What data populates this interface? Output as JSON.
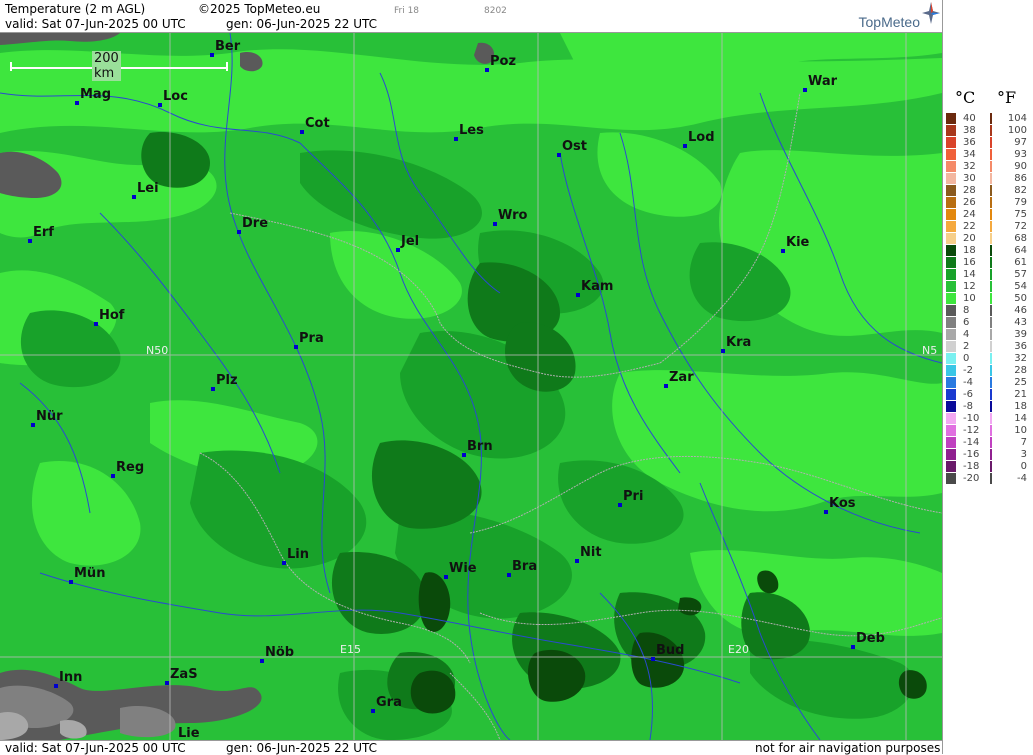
{
  "header": {
    "title": "Temperature (2 m AGL)",
    "copyright": "©2025 TopMeteo.eu",
    "day_marker": "Fri 18",
    "code": "8202",
    "valid": "valid:  Sat  07-Jun-2025  00 UTC",
    "gen": "gen: 06-Jun-2025 22 UTC",
    "logo": "TopMeteo"
  },
  "footer": {
    "valid": "valid:  Sat  07-Jun-2025  00 UTC",
    "gen": "gen: 06-Jun-2025 22 UTC",
    "disclaimer": "not for air navigation purposes"
  },
  "scale": {
    "label": "200 km"
  },
  "map_labels": {
    "lat_n50": "N50",
    "lat_n50_right": "N5",
    "lon_e15": "E15",
    "lon_e20": "E20"
  },
  "cities": [
    {
      "name": "Ber"
    },
    {
      "name": "Poz"
    },
    {
      "name": "War"
    },
    {
      "name": "Mag"
    },
    {
      "name": "Loc"
    },
    {
      "name": "Cot"
    },
    {
      "name": "Les"
    },
    {
      "name": "Ost"
    },
    {
      "name": "Lod"
    },
    {
      "name": "Lei"
    },
    {
      "name": "Erf"
    },
    {
      "name": "Dre"
    },
    {
      "name": "Wro"
    },
    {
      "name": "Jel"
    },
    {
      "name": "Kie"
    },
    {
      "name": "Kam"
    },
    {
      "name": "Hof"
    },
    {
      "name": "Pra"
    },
    {
      "name": "Kra"
    },
    {
      "name": "Plz"
    },
    {
      "name": "Zar"
    },
    {
      "name": "Nür"
    },
    {
      "name": "Brn"
    },
    {
      "name": "Reg"
    },
    {
      "name": "Pri"
    },
    {
      "name": "Kos"
    },
    {
      "name": "Lin"
    },
    {
      "name": "Wie"
    },
    {
      "name": "Bra"
    },
    {
      "name": "Nit"
    },
    {
      "name": "Mün"
    },
    {
      "name": "Deb"
    },
    {
      "name": "Nöb"
    },
    {
      "name": "Bud"
    },
    {
      "name": "Inn"
    },
    {
      "name": "ZaS"
    },
    {
      "name": "Gra"
    },
    {
      "name": "Lie"
    }
  ],
  "legend": {
    "unit_c": "°C",
    "unit_f": "°F",
    "rows": [
      {
        "c": "40",
        "f": "104",
        "color": "#6b2a0e"
      },
      {
        "c": "38",
        "f": "100",
        "color": "#a8381c"
      },
      {
        "c": "36",
        "f": "97",
        "color": "#d9432a"
      },
      {
        "c": "34",
        "f": "93",
        "color": "#f0603a"
      },
      {
        "c": "32",
        "f": "90",
        "color": "#f58a68"
      },
      {
        "c": "30",
        "f": "86",
        "color": "#f3b7a0"
      },
      {
        "c": "28",
        "f": "82",
        "color": "#8a5a1e"
      },
      {
        "c": "26",
        "f": "79",
        "color": "#b86e12"
      },
      {
        "c": "24",
        "f": "75",
        "color": "#e3880e"
      },
      {
        "c": "22",
        "f": "72",
        "color": "#f5a93e"
      },
      {
        "c": "20",
        "f": "68",
        "color": "#f6cf8a"
      },
      {
        "c": "18",
        "f": "64",
        "color": "#0a4a0a"
      },
      {
        "c": "16",
        "f": "61",
        "color": "#0f7a1a"
      },
      {
        "c": "14",
        "f": "57",
        "color": "#18a22a"
      },
      {
        "c": "12",
        "f": "54",
        "color": "#28c038"
      },
      {
        "c": "10",
        "f": "50",
        "color": "#3ee63e"
      },
      {
        "c": "8",
        "f": "46",
        "color": "#5a5a5a"
      },
      {
        "c": "6",
        "f": "43",
        "color": "#808080"
      },
      {
        "c": "4",
        "f": "39",
        "color": "#a8a8a8"
      },
      {
        "c": "2",
        "f": "36",
        "color": "#d0d0d0"
      },
      {
        "c": "0",
        "f": "32",
        "color": "#7af0f0"
      },
      {
        "c": "-2",
        "f": "28",
        "color": "#3ac6e6"
      },
      {
        "c": "-4",
        "f": "25",
        "color": "#2a7ae0"
      },
      {
        "c": "-6",
        "f": "21",
        "color": "#1a3ad0"
      },
      {
        "c": "-8",
        "f": "18",
        "color": "#0a0a9a"
      },
      {
        "c": "-10",
        "f": "14",
        "color": "#f2a8f2"
      },
      {
        "c": "-12",
        "f": "10",
        "color": "#e070e0"
      },
      {
        "c": "-14",
        "f": "7",
        "color": "#c040c0"
      },
      {
        "c": "-16",
        "f": "3",
        "color": "#902090"
      },
      {
        "c": "-18",
        "f": "0",
        "color": "#6a1a6a"
      },
      {
        "c": "-20",
        "f": "-4",
        "color": "#4a4a4a"
      }
    ]
  },
  "colors": {
    "field_base": "#28c038",
    "field_light": "#3ee63e",
    "field_mid": "#18a22a",
    "field_dark": "#0f7a1a",
    "field_darkest": "#0a4a0a",
    "cold_dark": "#5a5a5a",
    "cold_mid": "#808080",
    "cold_light": "#a8a8a8",
    "river": "#2a4ad0",
    "border": "#b0b0b0"
  }
}
